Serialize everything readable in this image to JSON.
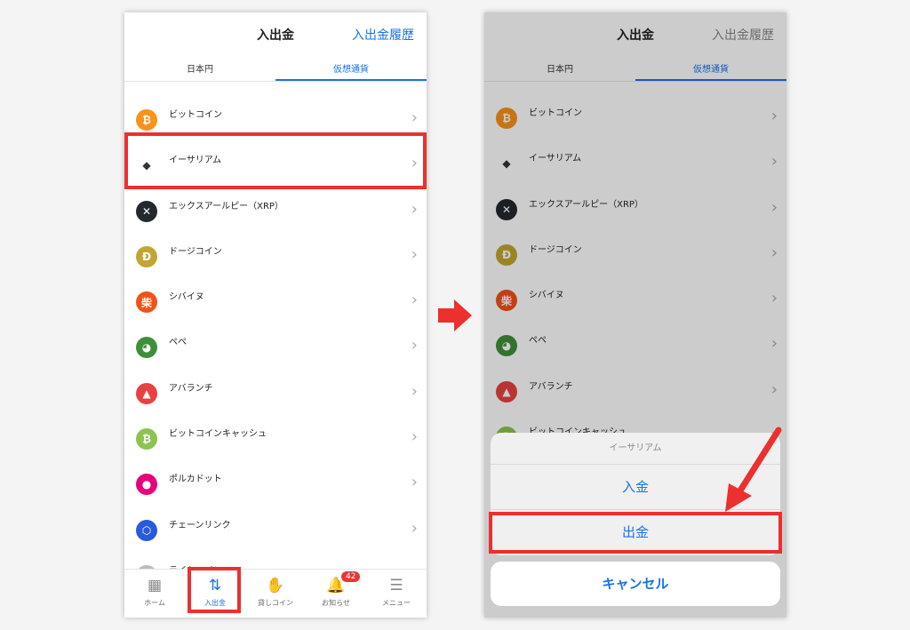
{
  "header": {
    "title": "入出金",
    "history_link": "入出金履歴"
  },
  "tabs": [
    {
      "label": "日本円"
    },
    {
      "label": "仮想通貨"
    }
  ],
  "coins": [
    {
      "name": "ビットコイン",
      "color": "#f7931a",
      "glyph": "₿",
      "icon": "bitcoin-icon"
    },
    {
      "name": "イーサリアム",
      "color": "#ffffff",
      "glyph": "◆",
      "icon": "ethereum-icon"
    },
    {
      "name": "エックスアールピー（XRP）",
      "color": "#23292f",
      "glyph": "✕",
      "icon": "xrp-icon"
    },
    {
      "name": "ドージコイン",
      "color": "#c2a633",
      "glyph": "Ð",
      "icon": "dogecoin-icon"
    },
    {
      "name": "シバイヌ",
      "color": "#f0521a",
      "glyph": "柴",
      "icon": "shiba-inu-icon"
    },
    {
      "name": "ペペ",
      "color": "#3f8f3a",
      "glyph": "◕",
      "icon": "pepe-icon"
    },
    {
      "name": "アバランチ",
      "color": "#e84142",
      "glyph": "▲",
      "icon": "avalanche-icon"
    },
    {
      "name": "ビットコインキャッシュ",
      "color": "#8dc351",
      "glyph": "₿",
      "icon": "bitcoin-cash-icon"
    },
    {
      "name": "ポルカドット",
      "color": "#e6007a",
      "glyph": "●",
      "icon": "polkadot-icon"
    },
    {
      "name": "チェーンリンク",
      "color": "#2a5ada",
      "glyph": "⬡",
      "icon": "chainlink-icon"
    },
    {
      "name": "ライトコイン",
      "color": "#bfbbbb",
      "glyph": "Ł",
      "icon": "litecoin-icon"
    }
  ],
  "nav": [
    {
      "label": "ホーム",
      "icon": "▦",
      "icon_name": "home-icon"
    },
    {
      "label": "入出金",
      "icon": "⇅",
      "icon_name": "deposit-withdraw-icon"
    },
    {
      "label": "貸しコイン",
      "icon": "✋",
      "icon_name": "lend-coin-icon"
    },
    {
      "label": "お知らせ",
      "icon": "🔔",
      "icon_name": "bell-icon"
    },
    {
      "label": "メニュー",
      "icon": "☰",
      "icon_name": "menu-icon"
    }
  ],
  "notification_count": "42",
  "sheet": {
    "title": "イーサリアム",
    "deposit": "入金",
    "withdraw": "出金",
    "cancel": "キャンセル"
  },
  "colors": {
    "accent": "#1a73e8",
    "highlight": "#ec2f2f"
  }
}
